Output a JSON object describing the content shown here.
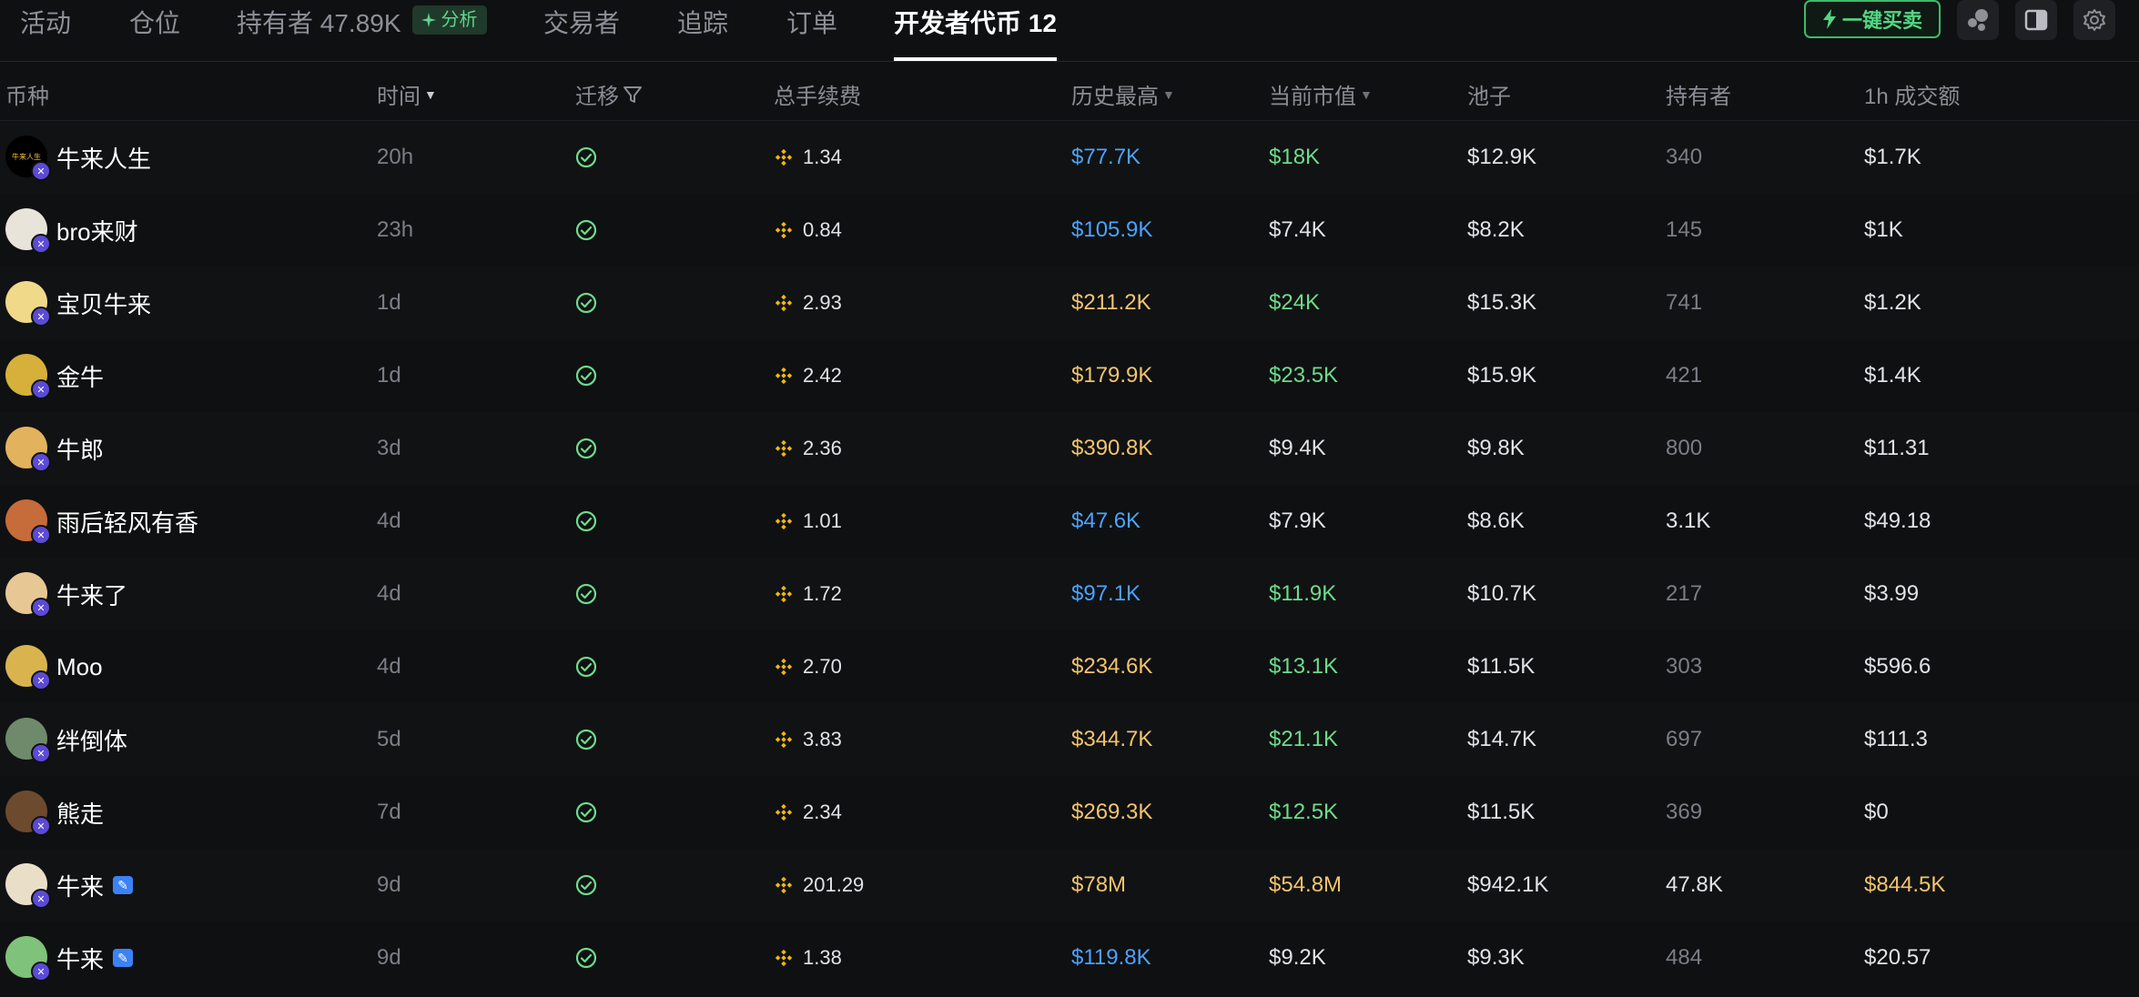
{
  "tabs": [
    {
      "label": "活动",
      "active": false
    },
    {
      "label": "仓位",
      "active": false
    },
    {
      "label": "持有者 47.89K",
      "active": false,
      "badge": "分析"
    },
    {
      "label": "交易者",
      "active": false
    },
    {
      "label": "追踪",
      "active": false
    },
    {
      "label": "订单",
      "active": false
    },
    {
      "label": "开发者代币 12",
      "active": true
    }
  ],
  "toolbar": {
    "sell_all_label": "一键买卖",
    "icons": [
      "bubble-map-icon",
      "sidebar-panel-icon",
      "settings-gear-icon"
    ]
  },
  "columns": {
    "coin": "币种",
    "time": "时间",
    "migrate": "迁移",
    "total_fee": "总手续费",
    "ath": "历史最高",
    "mcap": "当前市值",
    "pool": "池子",
    "holders": "持有者",
    "volume_1h": "1h 成交额"
  },
  "colors": {
    "blue": "#4aa3ff",
    "gold": "#f2c46d",
    "green": "#6ddc8b",
    "white": "#e2e3e6",
    "muted": "#7b7e85"
  },
  "rows": [
    {
      "name": "牛来人生",
      "verified": false,
      "time": "20h",
      "fee": "1.34",
      "ath": "$77.7K",
      "ath_color": "blue",
      "mcap": "$18K",
      "mcap_color": "green",
      "pool": "$12.9K",
      "holders": "340",
      "holders_color": "muted",
      "vol": "$1.7K",
      "vol_color": "white",
      "avatar_color": "#000000",
      "avatar_text": "牛来人生"
    },
    {
      "name": "bro来财",
      "verified": false,
      "time": "23h",
      "fee": "0.84",
      "ath": "$105.9K",
      "ath_color": "blue",
      "mcap": "$7.4K",
      "mcap_color": "white",
      "pool": "$8.2K",
      "holders": "145",
      "holders_color": "muted",
      "vol": "$1K",
      "vol_color": "white",
      "avatar_color": "#e9e4da",
      "avatar_text": ""
    },
    {
      "name": "宝贝牛来",
      "verified": false,
      "time": "1d",
      "fee": "2.93",
      "ath": "$211.2K",
      "ath_color": "gold",
      "mcap": "$24K",
      "mcap_color": "green",
      "pool": "$15.3K",
      "holders": "741",
      "holders_color": "muted",
      "vol": "$1.2K",
      "vol_color": "white",
      "avatar_color": "#f1d98a",
      "avatar_text": ""
    },
    {
      "name": "金牛",
      "verified": false,
      "time": "1d",
      "fee": "2.42",
      "ath": "$179.9K",
      "ath_color": "gold",
      "mcap": "$23.5K",
      "mcap_color": "green",
      "pool": "$15.9K",
      "holders": "421",
      "holders_color": "muted",
      "vol": "$1.4K",
      "vol_color": "white",
      "avatar_color": "#d6b03a",
      "avatar_text": ""
    },
    {
      "name": "牛郎",
      "verified": false,
      "time": "3d",
      "fee": "2.36",
      "ath": "$390.8K",
      "ath_color": "gold",
      "mcap": "$9.4K",
      "mcap_color": "white",
      "pool": "$9.8K",
      "holders": "800",
      "holders_color": "muted",
      "vol": "$11.31",
      "vol_color": "white",
      "avatar_color": "#e2b25d",
      "avatar_text": ""
    },
    {
      "name": "雨后轻风有香",
      "verified": false,
      "time": "4d",
      "fee": "1.01",
      "ath": "$47.6K",
      "ath_color": "blue",
      "mcap": "$7.9K",
      "mcap_color": "white",
      "pool": "$8.6K",
      "holders": "3.1K",
      "holders_color": "white",
      "vol": "$49.18",
      "vol_color": "white",
      "avatar_color": "#c66b3a",
      "avatar_text": ""
    },
    {
      "name": "牛来了",
      "verified": false,
      "time": "4d",
      "fee": "1.72",
      "ath": "$97.1K",
      "ath_color": "blue",
      "mcap": "$11.9K",
      "mcap_color": "green",
      "pool": "$10.7K",
      "holders": "217",
      "holders_color": "muted",
      "vol": "$3.99",
      "vol_color": "white",
      "avatar_color": "#e7c894",
      "avatar_text": ""
    },
    {
      "name": "Moo",
      "verified": false,
      "time": "4d",
      "fee": "2.70",
      "ath": "$234.6K",
      "ath_color": "gold",
      "mcap": "$13.1K",
      "mcap_color": "green",
      "pool": "$11.5K",
      "holders": "303",
      "holders_color": "muted",
      "vol": "$596.6",
      "vol_color": "white",
      "avatar_color": "#d9b44e",
      "avatar_text": ""
    },
    {
      "name": "绊倒体",
      "verified": false,
      "time": "5d",
      "fee": "3.83",
      "ath": "$344.7K",
      "ath_color": "gold",
      "mcap": "$21.1K",
      "mcap_color": "green",
      "pool": "$14.7K",
      "holders": "697",
      "holders_color": "muted",
      "vol": "$111.3",
      "vol_color": "white",
      "avatar_color": "#6f8a6a",
      "avatar_text": ""
    },
    {
      "name": "熊走",
      "verified": false,
      "time": "7d",
      "fee": "2.34",
      "ath": "$269.3K",
      "ath_color": "gold",
      "mcap": "$12.5K",
      "mcap_color": "green",
      "pool": "$11.5K",
      "holders": "369",
      "holders_color": "muted",
      "vol": "$0",
      "vol_color": "white",
      "avatar_color": "#6b4a2e",
      "avatar_text": ""
    },
    {
      "name": "牛来",
      "verified": true,
      "time": "9d",
      "fee": "201.29",
      "ath": "$78M",
      "ath_color": "gold",
      "mcap": "$54.8M",
      "mcap_color": "gold",
      "pool": "$942.1K",
      "holders": "47.8K",
      "holders_color": "white",
      "vol": "$844.5K",
      "vol_color": "gold",
      "avatar_color": "#e9dfc9",
      "avatar_text": ""
    },
    {
      "name": "牛来",
      "verified": true,
      "time": "9d",
      "fee": "1.38",
      "ath": "$119.8K",
      "ath_color": "blue",
      "mcap": "$9.2K",
      "mcap_color": "white",
      "pool": "$9.3K",
      "holders": "484",
      "holders_color": "muted",
      "vol": "$20.57",
      "vol_color": "white",
      "avatar_color": "#7fc27a",
      "avatar_text": ""
    }
  ]
}
